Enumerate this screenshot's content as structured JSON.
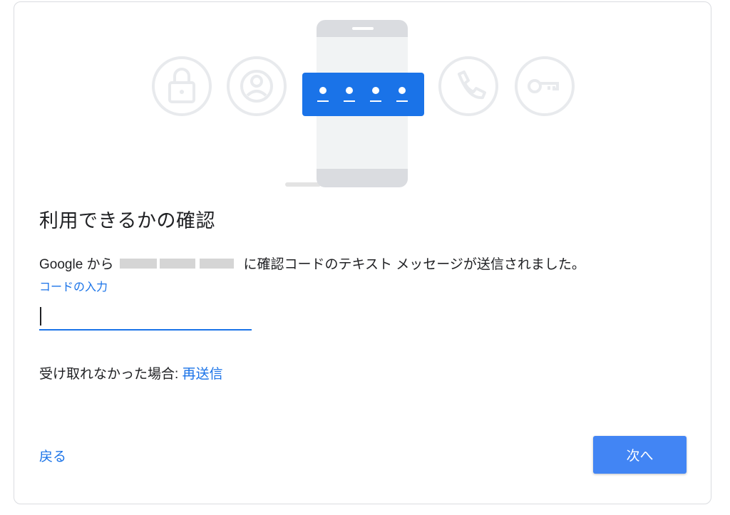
{
  "illustration": {
    "icons": [
      "lock-icon",
      "account-circle-icon",
      "phone-icon",
      "key-icon"
    ],
    "accent_color": "#1a73e8",
    "code_digits": 4
  },
  "dialog": {
    "title": "利用できるかの確認",
    "message_prefix": "Google から",
    "message_suffix": "に確認コードのテキスト メッセージが送信されました。",
    "code_label": "コードの入力",
    "code_value": "",
    "resend_prefix": "受け取れなかった場合: ",
    "resend_link": "再送信",
    "back_label": "戻る",
    "next_label": "次へ"
  },
  "colors": {
    "link": "#1a73e8",
    "primary_button": "#4285f4",
    "border": "#dadce0"
  }
}
